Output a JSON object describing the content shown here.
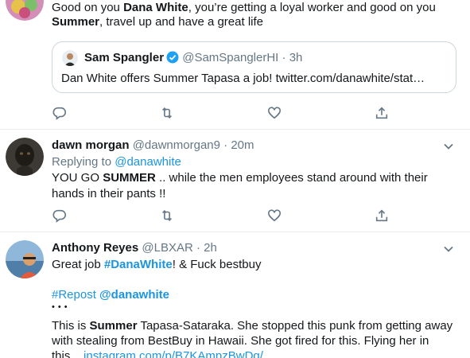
{
  "tweet1": {
    "text_parts": [
      "Good on you ",
      "Dana White",
      ", you’re getting a loyal worker and good on you"
    ],
    "line2_parts": [
      "Summer",
      ", travel up and have a great life"
    ],
    "quote": {
      "name": "Sam Spangler",
      "handle": "@SamSpanglerHI",
      "sep": "·",
      "time": "3h",
      "text": "Dan White offers Summer Tapasa a job! twitter.com/danawhite/stat…"
    }
  },
  "tweet2": {
    "name": "dawn morgan",
    "handle": "@dawnmorgan9",
    "sep": "·",
    "time": "20m",
    "reply_prefix": "Replying to ",
    "reply_to": "@danawhite",
    "line1_parts": [
      "YOU GO ",
      "SUMMER",
      "  .. while the men employees stand around with their"
    ],
    "line2": "hands in their pants !!"
  },
  "tweet3": {
    "name": "Anthony Reyes",
    "handle": "@LBXAR",
    "sep": "·",
    "time": "2h",
    "line1_parts": [
      "Great job ",
      "#DanaWhite",
      "! & Fuck bestbuy"
    ],
    "repost_tag": "#Repost",
    "repost_user": "@danawhite",
    "dots": "•••",
    "line3_parts": [
      "This is ",
      "Summer",
      " Tapasa-Sataraka. She stopped this punk from getting away"
    ],
    "line4": "with stealing from BestBuy in Hawaii. She got fired for this. Flying her in",
    "line5_prefix": "this... ",
    "line5_link": "instagram.com/p/B7KAmpzBwDq/"
  },
  "icons": {
    "reply": "reply-icon",
    "retweet": "retweet-icon",
    "like": "like-icon",
    "share": "share-icon",
    "caret": "chevron-down-icon",
    "verified": "verified-badge-icon"
  },
  "colors": {
    "link": "#1b95e0",
    "muted": "#657786",
    "border": "#e6ecf0",
    "text": "#14171a"
  }
}
